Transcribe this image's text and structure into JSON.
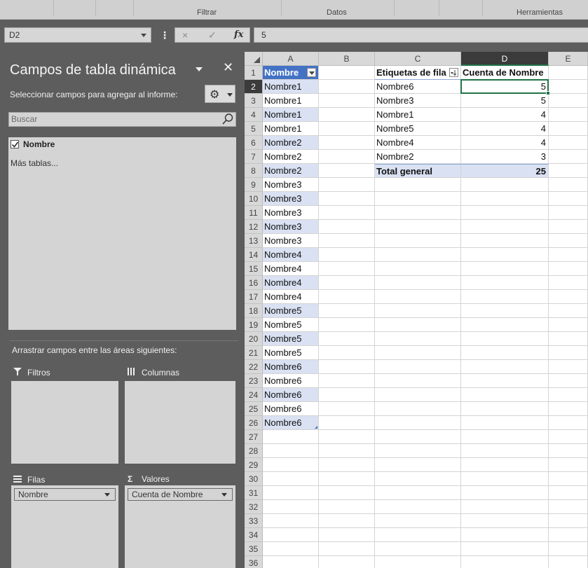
{
  "ribbon": {
    "groups": [
      "Filtrar",
      "Datos",
      "Herramientas"
    ]
  },
  "formula_bar": {
    "name_box": "D2",
    "cancel_icon": "×",
    "enter_icon": "✓",
    "fx_label": "fx",
    "value": "5"
  },
  "pane": {
    "title": "Campos de tabla dinámica",
    "subtitle": "Seleccionar campos para agregar al informe:",
    "search_placeholder": "Buscar",
    "fields": [
      {
        "name": "Nombre",
        "checked": true
      }
    ],
    "more_tables": "Más tablas...",
    "drag_label": "Arrastrar campos entre las áreas siguientes:",
    "areas": {
      "filters": "Filtros",
      "columns": "Columnas",
      "rows": "Filas",
      "values": "Valores"
    },
    "rows_chip": "Nombre",
    "values_chip": "Cuenta de Nombre"
  },
  "sheet": {
    "columns": [
      "A",
      "B",
      "C",
      "D",
      "E"
    ],
    "selected_column": "D",
    "selected_row": 2,
    "row_count": 36,
    "colA": [
      "Nombre",
      "Nombre1",
      "Nombre1",
      "Nombre1",
      "Nombre1",
      "Nombre2",
      "Nombre2",
      "Nombre2",
      "Nombre3",
      "Nombre3",
      "Nombre3",
      "Nombre3",
      "Nombre3",
      "Nombre4",
      "Nombre4",
      "Nombre4",
      "Nombre4",
      "Nombre5",
      "Nombre5",
      "Nombre5",
      "Nombre5",
      "Nombre6",
      "Nombre6",
      "Nombre6",
      "Nombre6",
      "Nombre6"
    ],
    "pivot": {
      "header_rows": "Etiquetas de fila",
      "header_values": "Cuenta de Nombre",
      "rows": [
        {
          "label": "Nombre6",
          "value": "5"
        },
        {
          "label": "Nombre3",
          "value": "5"
        },
        {
          "label": "Nombre1",
          "value": "4"
        },
        {
          "label": "Nombre5",
          "value": "4"
        },
        {
          "label": "Nombre4",
          "value": "4"
        },
        {
          "label": "Nombre2",
          "value": "3"
        }
      ],
      "total_label": "Total general",
      "total_value": "25"
    }
  }
}
